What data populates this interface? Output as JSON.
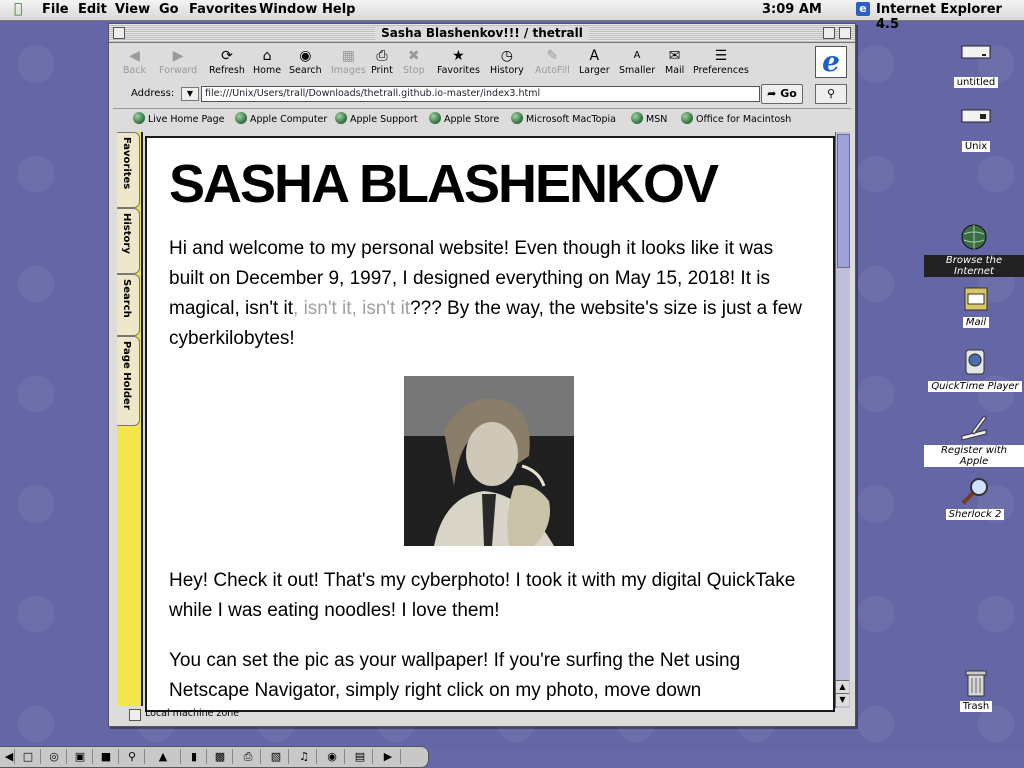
{
  "menubar": {
    "items": [
      "File",
      "Edit",
      "View",
      "Go",
      "Favorites",
      "Window",
      "Help"
    ],
    "clock": "3:09 AM",
    "app_name": "Internet Explorer 4.5"
  },
  "window": {
    "title": "Sasha Blashenkov!!! / thetrall"
  },
  "toolbar": {
    "buttons": [
      {
        "label": "Back",
        "icon": "back-arrow-icon",
        "enabled": false
      },
      {
        "label": "Forward",
        "icon": "forward-arrow-icon",
        "enabled": false
      },
      {
        "label": "Refresh",
        "icon": "refresh-icon",
        "enabled": true
      },
      {
        "label": "Home",
        "icon": "home-icon",
        "enabled": true
      },
      {
        "label": "Search",
        "icon": "search-icon",
        "enabled": true
      },
      {
        "label": "Images",
        "icon": "images-icon",
        "enabled": false
      },
      {
        "label": "Print",
        "icon": "print-icon",
        "enabled": true
      },
      {
        "label": "Stop",
        "icon": "stop-icon",
        "enabled": false
      },
      {
        "label": "Favorites",
        "icon": "favorites-icon",
        "enabled": true
      },
      {
        "label": "History",
        "icon": "history-icon",
        "enabled": true
      },
      {
        "label": "AutoFill",
        "icon": "autofill-icon",
        "enabled": false
      },
      {
        "label": "Larger",
        "icon": "larger-text-icon",
        "enabled": true
      },
      {
        "label": "Smaller",
        "icon": "smaller-text-icon",
        "enabled": true
      },
      {
        "label": "Mail",
        "icon": "mail-icon",
        "enabled": true
      },
      {
        "label": "Preferences",
        "icon": "preferences-icon",
        "enabled": true
      }
    ]
  },
  "address": {
    "label": "Address:",
    "url": "file:///Unix/Users/trall/Downloads/thetrall.github.io-master/index3.html",
    "go_label": "Go"
  },
  "favorites_bar": [
    "Live Home Page",
    "Apple Computer",
    "Apple Support",
    "Apple Store",
    "Microsoft MacTopia",
    "MSN",
    "Office for Macintosh"
  ],
  "side_tabs": [
    "Favorites",
    "History",
    "Search",
    "Page Holder"
  ],
  "page": {
    "heading": "SASHA BLASHENKOV",
    "para1_a": "Hi and welcome to my personal website! Even though it looks like it was built on December 9, 1997, I designed everything on May 15, 2018! It is magical, isn't it",
    "para1_faded": ", isn't it, isn't it",
    "para1_b": "??? By the way, the website's size is just a few cyberkilobytes!",
    "para2": "Hey! Check it out! That's my cyberphoto! I took it with my digital QuickTake while I was eating noodles! I love them!",
    "para3": "You can set the pic as your wallpaper! If you're surfing the Net using Netscape Navigator, simply right click on my photo, move down"
  },
  "status": {
    "zone": "Local machine zone"
  },
  "desktop_icons": [
    {
      "label": "untitled",
      "icon": "disk-icon"
    },
    {
      "label": "Unix",
      "icon": "disk-icon"
    },
    {
      "label": "Browse the Internet",
      "icon": "globe-icon"
    },
    {
      "label": "Mail",
      "icon": "mail-icon"
    },
    {
      "label": "QuickTime Player",
      "icon": "quicktime-icon"
    },
    {
      "label": "Register with Apple",
      "icon": "register-icon"
    },
    {
      "label": "Sherlock 2",
      "icon": "sherlock-icon"
    },
    {
      "label": "Trash",
      "icon": "trash-icon"
    }
  ],
  "colors": {
    "desktop": "#6466a6",
    "sidebar": "#f2e64a",
    "scrollbar": "#bfc0d8"
  }
}
